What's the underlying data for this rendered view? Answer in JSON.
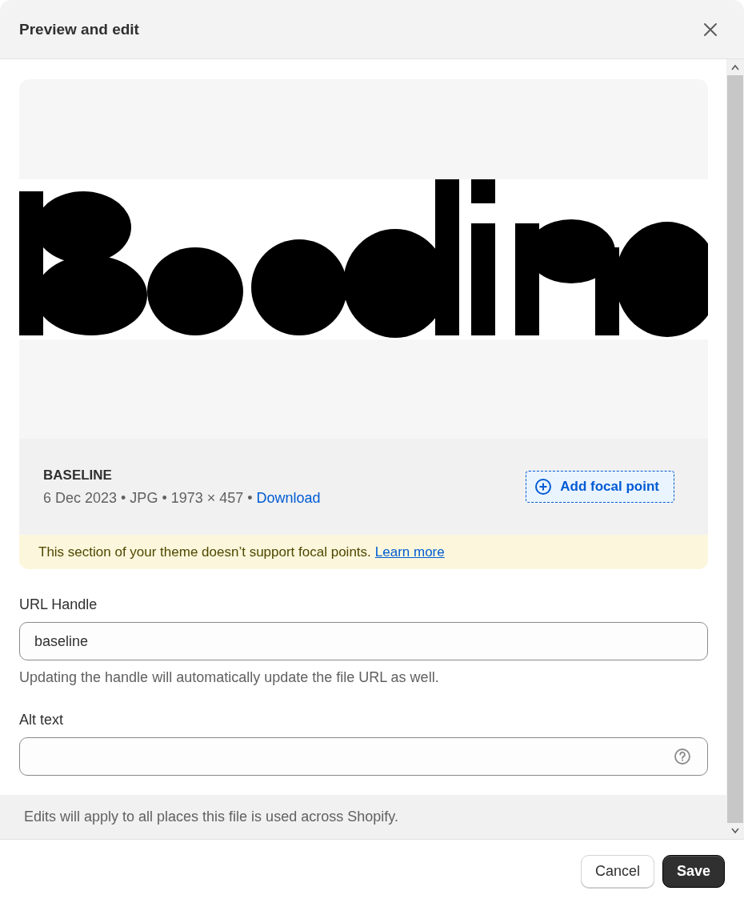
{
  "dialog": {
    "title": "Preview and edit"
  },
  "file": {
    "name": "BASELINE",
    "meta": "6 Dec 2023 • JPG • 1973 × 457 •",
    "download_link": "Download",
    "focal_button": "Add focal point"
  },
  "notice": {
    "text": "This section of your theme doesn’t support focal points.",
    "link": "Learn more"
  },
  "url_handle": {
    "label": "URL Handle",
    "value": "baseline",
    "help": "Updating the handle will automatically update the file URL as well."
  },
  "alt_text": {
    "label": "Alt text"
  },
  "footer_note": "Edits will apply to all places this file is used across Shopify.",
  "buttons": [
    {
      "label": "Cancel",
      "kind": "secondary"
    },
    {
      "label": "Save",
      "kind": "primary"
    }
  ]
}
